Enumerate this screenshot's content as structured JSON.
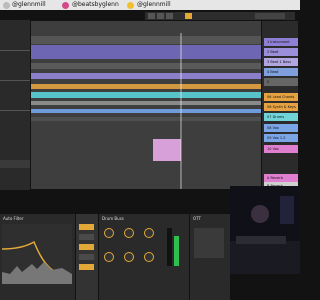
{
  "banner": {
    "handle1": "@glennmill",
    "handle2": "@beatsbyglenn",
    "handle3": "@glennmill"
  },
  "tracks": [
    "1 Instrument",
    "2 Beat",
    "3 Beat 1 Bass",
    "4 Beat",
    "5",
    "06 Lead Chords",
    "06 Synth & Keys",
    "07 Drums",
    "08 Vox",
    "09 Vox 1.2",
    "10 Vox",
    "A Reverb",
    "B Reverb"
  ],
  "device": {
    "auto_filter_title": "Auto Filter",
    "drum_buss_title": "Drum Buss",
    "amp_title": "OTT"
  },
  "colors": {
    "accent": "#e2a838",
    "track_purple": "#8e7fd4",
    "track_orange": "#e6a241",
    "track_cyan": "#6fd3d7",
    "track_blue": "#7aa6e8",
    "track_pink": "#e07fd0"
  }
}
